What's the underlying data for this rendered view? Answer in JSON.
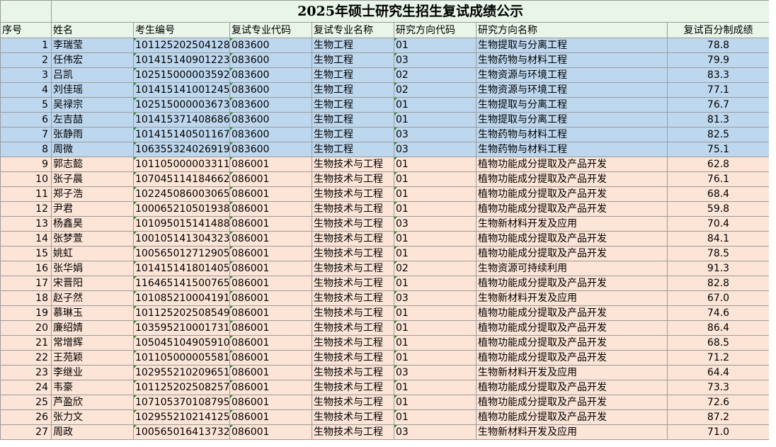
{
  "title": "2025年硕士研究生招生复试成绩公示",
  "headers": [
    "序号",
    "姓名",
    "考生编号",
    "复试专业代码",
    "复试专业名称",
    "研究方向代码",
    "研究方向名称",
    "复试百分制成绩"
  ],
  "rows": [
    [
      "1",
      "李瑞莹",
      "101125202504128",
      "083600",
      "生物工程",
      "01",
      "生物提取与分离工程",
      "78.8"
    ],
    [
      "2",
      "任伟宏",
      "101415140901223",
      "083600",
      "生物工程",
      "03",
      "生物药物与材料工程",
      "79.9"
    ],
    [
      "3",
      "吕凯",
      "102515000003592",
      "083600",
      "生物工程",
      "02",
      "生物资源与环境工程",
      "83.3"
    ],
    [
      "4",
      "刘佳瑶",
      "101415141001245",
      "083600",
      "生物工程",
      "02",
      "生物资源与环境工程",
      "77.1"
    ],
    [
      "5",
      "吴禄宗",
      "102515000003673",
      "083600",
      "生物工程",
      "01",
      "生物提取与分离工程",
      "76.7"
    ],
    [
      "6",
      "左吉喆",
      "101415371408686",
      "083600",
      "生物工程",
      "01",
      "生物提取与分离工程",
      "81.3"
    ],
    [
      "7",
      "张静雨",
      "101415140501167",
      "083600",
      "生物工程",
      "03",
      "生物药物与材料工程",
      "82.5"
    ],
    [
      "8",
      "周微",
      "106355324026919",
      "083600",
      "生物工程",
      "03",
      "生物药物与材料工程",
      "75.1"
    ],
    [
      "9",
      "郭志懿",
      "101105000003311",
      "086001",
      "生物技术与工程",
      "01",
      "植物功能成分提取及产品开发",
      "62.8"
    ],
    [
      "10",
      "张子晨",
      "107045114184662",
      "086001",
      "生物技术与工程",
      "01",
      "植物功能成分提取及产品开发",
      "76.1"
    ],
    [
      "11",
      "郑子浩",
      "102245086003065",
      "086001",
      "生物技术与工程",
      "01",
      "植物功能成分提取及产品开发",
      "68.4"
    ],
    [
      "12",
      "尹君",
      "100065210501938",
      "086001",
      "生物技术与工程",
      "01",
      "植物功能成分提取及产品开发",
      "59.8"
    ],
    [
      "13",
      "杨鑫昊",
      "101095015141488",
      "086001",
      "生物技术与工程",
      "03",
      "生物新材料开发及应用",
      "70.4"
    ],
    [
      "14",
      "张梦萱",
      "100105141304323",
      "086001",
      "生物技术与工程",
      "01",
      "植物功能成分提取及产品开发",
      "84.1"
    ],
    [
      "15",
      "姚虹",
      "100565012712905",
      "086001",
      "生物技术与工程",
      "01",
      "植物功能成分提取及产品开发",
      "78.5"
    ],
    [
      "16",
      "张华娟",
      "101415141801405",
      "086001",
      "生物技术与工程",
      "02",
      "生物资源可持续利用",
      "91.3"
    ],
    [
      "17",
      "宋晋阳",
      "116465141500765",
      "086001",
      "生物技术与工程",
      "01",
      "植物功能成分提取及产品开发",
      "82.8"
    ],
    [
      "18",
      "赵子然",
      "101085210004191",
      "086001",
      "生物技术与工程",
      "03",
      "生物新材料开发及应用",
      "67.0"
    ],
    [
      "19",
      "慕琳玉",
      "101125202508549",
      "086001",
      "生物技术与工程",
      "01",
      "植物功能成分提取及产品开发",
      "74.6"
    ],
    [
      "20",
      "廉绍婧",
      "103595210001731",
      "086001",
      "生物技术与工程",
      "01",
      "植物功能成分提取及产品开发",
      "86.4"
    ],
    [
      "21",
      "常增辉",
      "105045104905910",
      "086001",
      "生物技术与工程",
      "01",
      "植物功能成分提取及产品开发",
      "68.5"
    ],
    [
      "22",
      "王苑颖",
      "101105000005581",
      "086001",
      "生物技术与工程",
      "01",
      "植物功能成分提取及产品开发",
      "71.2"
    ],
    [
      "23",
      "李继业",
      "102955210209651",
      "086001",
      "生物技术与工程",
      "03",
      "生物新材料开发及应用",
      "64.4"
    ],
    [
      "24",
      "韦豪",
      "101125202508257",
      "086001",
      "生物技术与工程",
      "01",
      "植物功能成分提取及产品开发",
      "73.3"
    ],
    [
      "25",
      "芦盈欣",
      "107105370108795",
      "086001",
      "生物技术与工程",
      "01",
      "植物功能成分提取及产品开发",
      "72.6"
    ],
    [
      "26",
      "张力文",
      "102955210214125",
      "086001",
      "生物技术与工程",
      "01",
      "植物功能成分提取及产品开发",
      "87.2"
    ],
    [
      "27",
      "周政",
      "100565016413732",
      "086001",
      "生物技术与工程",
      "03",
      "生物新材料开发及应用",
      "71.0"
    ]
  ],
  "row_group_colors": {
    "083600": "#bdd7ee",
    "086001": "#fce4d6"
  }
}
